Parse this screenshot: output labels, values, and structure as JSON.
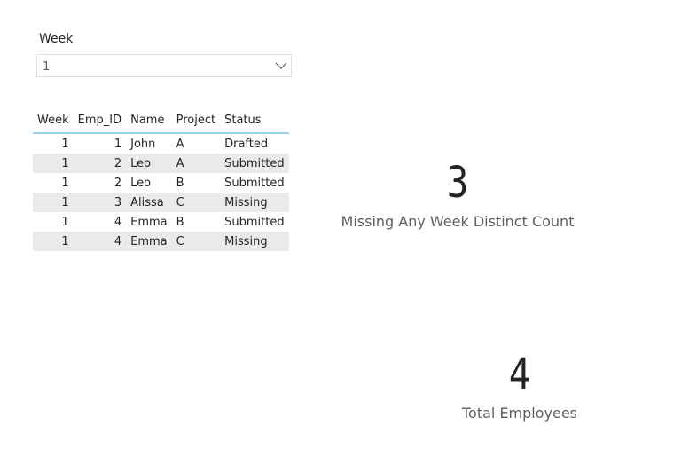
{
  "slicer": {
    "title": "Week",
    "selected_value": "1",
    "chevron_icon": "chevron-down-icon"
  },
  "table": {
    "columns": [
      "Week",
      "Emp_ID",
      "Name",
      "Project",
      "Status"
    ],
    "rows": [
      {
        "week": "1",
        "emp_id": "1",
        "name": "John",
        "project": "A",
        "status": "Drafted"
      },
      {
        "week": "1",
        "emp_id": "2",
        "name": "Leo",
        "project": "A",
        "status": "Submitted"
      },
      {
        "week": "1",
        "emp_id": "2",
        "name": "Leo",
        "project": "B",
        "status": "Submitted"
      },
      {
        "week": "1",
        "emp_id": "3",
        "name": "Alissa",
        "project": "C",
        "status": "Missing"
      },
      {
        "week": "1",
        "emp_id": "4",
        "name": "Emma",
        "project": "B",
        "status": "Submitted"
      },
      {
        "week": "1",
        "emp_id": "4",
        "name": "Emma",
        "project": "C",
        "status": "Missing"
      }
    ]
  },
  "cards": {
    "missing": {
      "value": "3",
      "label": "Missing Any Week Distinct Count"
    },
    "total": {
      "value": "4",
      "label": "Total Employees"
    }
  },
  "colors": {
    "header_rule": "#9ad2ef",
    "row_band": "#eaeaea",
    "text": "#252423",
    "label": "#605e5c"
  }
}
